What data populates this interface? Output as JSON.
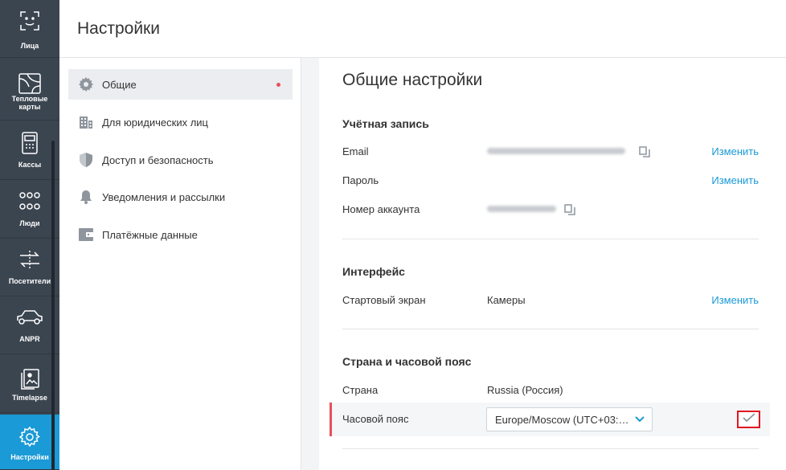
{
  "rail": {
    "items": [
      {
        "label": "Лица",
        "icon": "face-scan-icon"
      },
      {
        "label": "Тепловые карты",
        "icon": "heatmap-icon"
      },
      {
        "label": "Кассы",
        "icon": "cash-register-icon"
      },
      {
        "label": "Люди",
        "icon": "people-icon"
      },
      {
        "label": "Посетители",
        "icon": "visitors-flow-icon"
      },
      {
        "label": "ANPR",
        "icon": "car-icon"
      },
      {
        "label": "Timelapse",
        "icon": "timelapse-icon"
      },
      {
        "label": "Настройки",
        "icon": "gear-icon"
      }
    ],
    "active_color": "#1a9ad6",
    "bg_color": "#3b4550"
  },
  "header": {
    "title": "Настройки"
  },
  "nav": {
    "items": [
      {
        "label": "Общие",
        "icon": "gear-icon",
        "active": true
      },
      {
        "label": "Для юридических лиц",
        "icon": "building-icon"
      },
      {
        "label": "Доступ и безопасность",
        "icon": "shield-icon"
      },
      {
        "label": "Уведомления и рассылки",
        "icon": "bell-icon"
      },
      {
        "label": "Платёжные данные",
        "icon": "wallet-icon"
      }
    ]
  },
  "content": {
    "title": "Общие настройки",
    "account": {
      "section_title": "Учётная запись",
      "email_label": "Email",
      "password_label": "Пароль",
      "account_number_label": "Номер аккаунта",
      "change_label": "Изменить"
    },
    "interface": {
      "section_title": "Интерфейс",
      "start_screen_label": "Стартовый экран",
      "start_screen_value": "Камеры",
      "change_label": "Изменить"
    },
    "region": {
      "section_title": "Страна и часовой пояс",
      "country_label": "Страна",
      "country_value": "Russia (Россия)",
      "timezone_label": "Часовой пояс",
      "timezone_value": "Europe/Moscow (UTC+03:00)"
    }
  },
  "colors": {
    "accent": "#1a9ad6",
    "alert": "#e8505b",
    "highlight_box": "#e0161f"
  }
}
